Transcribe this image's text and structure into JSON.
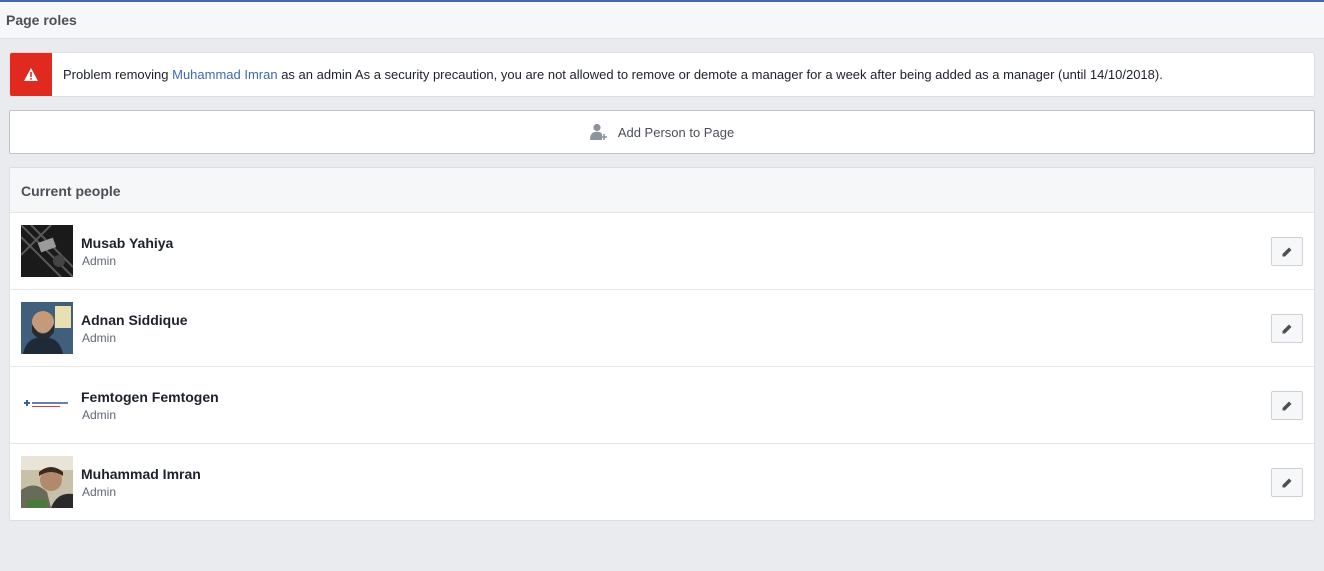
{
  "header": {
    "title": "Page roles"
  },
  "alert": {
    "icon": "warning-icon",
    "prefix": "Problem removing ",
    "link_name": "Muhammad Imran",
    "suffix": " as an admin As a security precaution, you are not allowed to remove or demote a manager for a week after being added as a manager (until 14/10/2018).",
    "color": "#e02a20"
  },
  "add_person": {
    "icon": "add-person-icon",
    "label": "Add Person to Page"
  },
  "current_people": {
    "title": "Current people",
    "people": [
      {
        "name": "Musab Yahiya",
        "role": "Admin",
        "edit_icon": "pencil-icon"
      },
      {
        "name": "Adnan Siddique",
        "role": "Admin",
        "edit_icon": "pencil-icon"
      },
      {
        "name": "Femtogen Femtogen",
        "role": "Admin",
        "edit_icon": "pencil-icon"
      },
      {
        "name": "Muhammad Imran",
        "role": "Admin",
        "edit_icon": "pencil-icon"
      }
    ]
  },
  "colors": {
    "accent": "#4267b2",
    "background": "#e9ebee",
    "alert": "#e02a20"
  }
}
